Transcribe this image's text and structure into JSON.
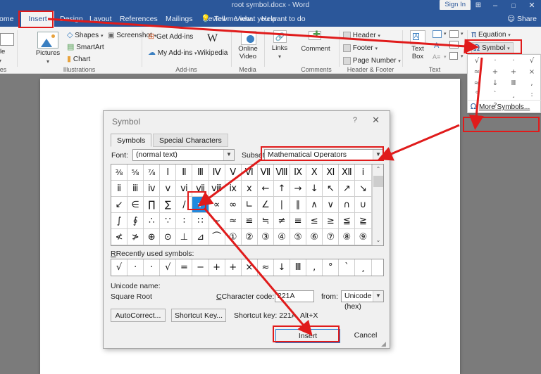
{
  "window": {
    "title": "root symbol.docx  -  Word",
    "sign_in": "Sign In",
    "ribbon_display_icon": "ribbon-display-options-icon",
    "minimize": "–",
    "maximize": "□",
    "close": "✕"
  },
  "tabs": [
    {
      "label": "ome",
      "active": false
    },
    {
      "label": "Insert",
      "active": true
    },
    {
      "label": "Design",
      "active": false
    },
    {
      "label": "Layout",
      "active": false
    },
    {
      "label": "References",
      "active": false
    },
    {
      "label": "Mailings",
      "active": false
    },
    {
      "label": "Review",
      "active": false
    },
    {
      "label": "View",
      "active": false
    },
    {
      "label": "Help",
      "active": false
    }
  ],
  "tell_me": "Tell me what you want to do",
  "share": "Share",
  "ribbon": {
    "groups": [
      {
        "label": "bles"
      },
      {
        "label": "Illustrations"
      },
      {
        "label": "Add-ins"
      },
      {
        "label": "Media"
      },
      {
        "label": "Comments"
      },
      {
        "label": "Header & Footer"
      },
      {
        "label": "Text"
      }
    ],
    "tables_big": "ble",
    "pictures": "Pictures",
    "shapes": "Shapes",
    "smartart": "SmartArt",
    "chart": "Chart",
    "screenshot": "Screenshot",
    "get_addins": "Get Add-ins",
    "my_addins": "My Add-ins",
    "wikipedia": "Wikipedia",
    "wikipedia_glyph": "W",
    "online_video_1": "Online",
    "online_video_2": "Video",
    "links": "Links",
    "comment": "Comment",
    "header": "Header",
    "footer": "Footer",
    "page_number": "Page Number",
    "text_box_1": "Text",
    "text_box_2": "Box",
    "equation": "Equation",
    "equation_glyph": "π",
    "symbol": "Symbol",
    "symbol_glyph": "Ω",
    "dropdown_caret": "▾"
  },
  "symbol_menu": {
    "recent_glyphs": [
      "√",
      "·",
      "·",
      "√",
      "≈",
      "+",
      "+",
      "×",
      "≈",
      "↓",
      "Ⅲ",
      ",",
      "°",
      "`",
      "¸",
      ":",
      "!",
      "?",
      "·"
    ],
    "more_symbols": "More Symbols...",
    "more_symbols_icon": "omega-icon"
  },
  "dialog": {
    "title": "Symbol",
    "help_icon": "?",
    "close_icon": "✕",
    "tabs": [
      {
        "label": "Symbols",
        "selected": true
      },
      {
        "label": "Special Characters",
        "selected": false
      }
    ],
    "font_label": "Font:",
    "font_value": "(normal text)",
    "subset_label": "Subset:",
    "subset_value": "Mathematical Operators",
    "grid_rows": [
      [
        "⅜",
        "⅝",
        "⅞",
        "Ⅰ",
        "Ⅱ",
        "Ⅲ",
        "Ⅳ",
        "Ⅴ",
        "Ⅵ",
        "Ⅶ",
        "Ⅷ",
        "Ⅸ",
        "Ⅹ",
        "Ⅺ",
        "Ⅻ",
        "ⅰ"
      ],
      [
        "ⅱ",
        "ⅲ",
        "ⅳ",
        "ⅴ",
        "ⅵ",
        "ⅶ",
        "ⅷ",
        "ⅸ",
        "ⅹ",
        "←",
        "↑",
        "→",
        "↓",
        "↖",
        "↗",
        "↘"
      ],
      [
        "↙",
        "∈",
        "∏",
        "∑",
        "∕",
        "√",
        "∝",
        "∞",
        "∟",
        "∠",
        "∣",
        "∥",
        "∧",
        "∨",
        "∩",
        "∪"
      ],
      [
        "∫",
        "∮",
        "∴",
        "∵",
        "∶",
        "∷",
        "∼",
        "≈",
        "≌",
        "≒",
        "≠",
        "≡",
        "≤",
        "≥",
        "≦",
        "≧"
      ],
      [
        "≮",
        "≯",
        "⊕",
        "⊙",
        "⊥",
        "⊿",
        "⌒",
        "①",
        "②",
        "③",
        "④",
        "⑤",
        "⑥",
        "⑦",
        "⑧",
        "⑨"
      ]
    ],
    "selected_cell": {
      "row": 2,
      "col": 5,
      "glyph": "√"
    },
    "scroll_up": "⌃",
    "scroll_down": "⌄",
    "recent_label": "Recently used symbols:",
    "recent_glyphs": [
      "√",
      "·",
      "·",
      "√",
      "=",
      "−",
      "+",
      "+",
      "×",
      "≈",
      "↓",
      "Ⅲ",
      ",",
      "°",
      "`",
      "¸"
    ],
    "unicode_name_label": "Unicode name:",
    "unicode_name_value": "Square Root",
    "character_code_label": "Character code:",
    "character_code_value": "221A",
    "from_label": "from:",
    "from_value": "Unicode (hex)",
    "autocorrect_button": "AutoCorrect...",
    "shortcut_key_button": "Shortcut Key...",
    "shortcut_key_text": "Shortcut key: 221A, Alt+X",
    "insert_button": "Insert",
    "cancel_button": "Cancel"
  },
  "colors": {
    "brand": "#2b579a",
    "annotation": "#e01b1b",
    "selection": "#1f8ae0",
    "page": "#ffffff",
    "canvas": "#7b7b7b"
  }
}
